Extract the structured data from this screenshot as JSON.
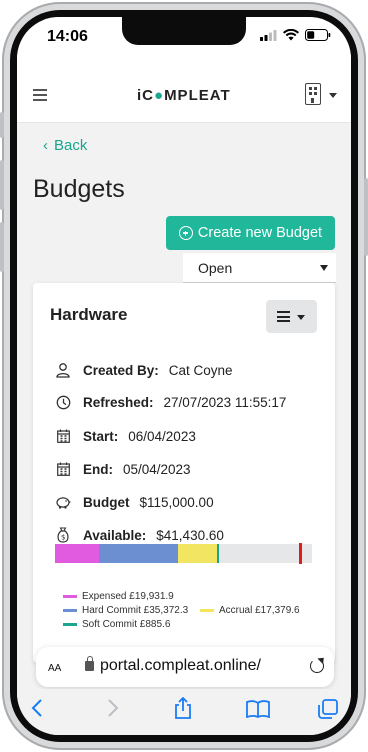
{
  "status_bar": {
    "time": "14:06"
  },
  "header": {
    "logo_pre": "iC",
    "logo_post": "MPLEAT"
  },
  "nav": {
    "back_label": "Back"
  },
  "page": {
    "title": "Budgets",
    "create_button_label": "Create new Budget",
    "filter_select_value": "Open"
  },
  "budget_card": {
    "name": "Hardware",
    "created_by_label": "Created By:",
    "created_by": "Cat Coyne",
    "refreshed_label": "Refreshed:",
    "refreshed": "27/07/2023 11:55:17",
    "start_label": "Start:",
    "start": "06/04/2023",
    "end_label": "End:",
    "end": "05/04/2023",
    "budget_label": "Budget",
    "budget": "$115,000.00",
    "available_label": "Available:",
    "available": "$41,430.60",
    "progress": {
      "expensed_fraction": 0.173,
      "hard_commit_fraction": 0.308,
      "accrual_fraction": 0.151,
      "soft_commit_fraction": 0.008,
      "limit_marker_fraction": 0.95
    },
    "legend": {
      "expensed": "Expensed £19,931.9",
      "hard_commit": "Hard Commit £35,372.3",
      "accrual": "Accrual £17,379.6",
      "soft_commit": "Soft Commit £885.6"
    },
    "colors": {
      "expensed": "#e15be0",
      "hard_commit": "#6b8fd1",
      "accrual": "#f2e561",
      "soft_commit": "#1aa58f",
      "limit_marker": "#e01d1d"
    }
  },
  "browser": {
    "aa_label": "AA",
    "url": "portal.compleat.online/"
  },
  "colors": {
    "accent": "#20b79b",
    "link": "#1aa58f",
    "ios_blue": "#1a7cf5"
  }
}
